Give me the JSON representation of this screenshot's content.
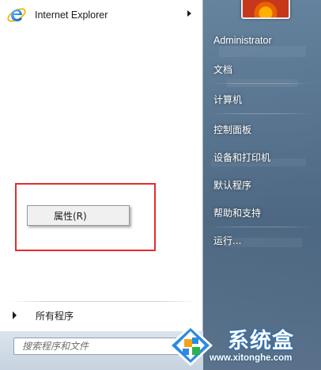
{
  "pinned": {
    "label": "Internet Explorer"
  },
  "all_programs": {
    "label": "所有程序"
  },
  "search": {
    "placeholder": "搜索程序和文件"
  },
  "context_menu": {
    "items": [
      {
        "label": "属性(R)"
      }
    ]
  },
  "right_pane": {
    "items": [
      {
        "label": "Administrator"
      },
      {
        "label": "文档"
      },
      {
        "label": "计算机"
      },
      {
        "label": "控制面板"
      },
      {
        "label": "设备和打印机"
      },
      {
        "label": "默认程序"
      },
      {
        "label": "帮助和支持"
      },
      {
        "label": "运行..."
      }
    ]
  },
  "watermark": {
    "brand": "系统盒",
    "url": "www.xitonghe.com"
  },
  "colors": {
    "highlight_box": "#e62b2b",
    "right_pane": "#4a6580",
    "ie_blue": "#1d7fd6",
    "ie_ring": "#f2b400"
  },
  "icons": {
    "pinned_icon": "internet-explorer-icon",
    "submenu_arrow": "chevron-right-icon",
    "all_programs_arrow": "triangle-right-icon",
    "user_picture": "flower-user-picture",
    "watermark_logo": "xitonghe-logo"
  }
}
